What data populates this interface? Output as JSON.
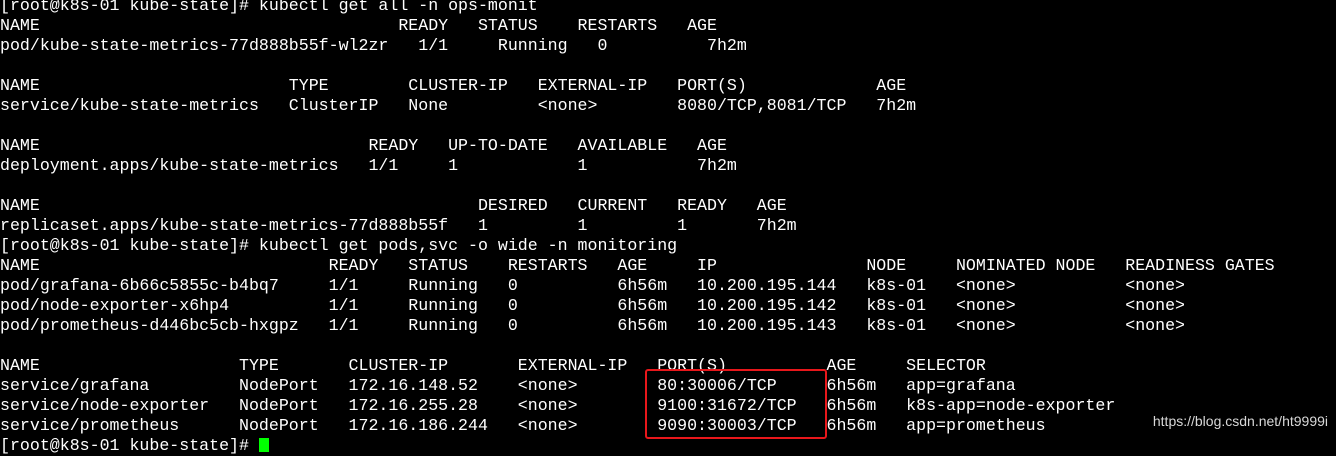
{
  "terminal": {
    "lines": [
      "[root@k8s-01 kube-state]# kubectl get all -n ops-monit",
      "NAME                                    READY   STATUS    RESTARTS   AGE",
      "pod/kube-state-metrics-77d888b55f-wl2zr   1/1     Running   0          7h2m",
      "",
      "NAME                         TYPE        CLUSTER-IP   EXTERNAL-IP   PORT(S)             AGE",
      "service/kube-state-metrics   ClusterIP   None         <none>        8080/TCP,8081/TCP   7h2m",
      "",
      "NAME                                 READY   UP-TO-DATE   AVAILABLE   AGE",
      "deployment.apps/kube-state-metrics   1/1     1            1           7h2m",
      "",
      "NAME                                            DESIRED   CURRENT   READY   AGE",
      "replicaset.apps/kube-state-metrics-77d888b55f   1         1         1       7h2m",
      "[root@k8s-01 kube-state]# kubectl get pods,svc -o wide -n monitoring",
      "NAME                             READY   STATUS    RESTARTS   AGE     IP               NODE     NOMINATED NODE   READINESS GATES",
      "pod/grafana-6b66c5855c-b4bq7     1/1     Running   0          6h56m   10.200.195.144   k8s-01   <none>           <none>",
      "pod/node-exporter-x6hp4          1/1     Running   0          6h56m   10.200.195.142   k8s-01   <none>           <none>",
      "pod/prometheus-d446bc5cb-hxgpz   1/1     Running   0          6h56m   10.200.195.143   k8s-01   <none>           <none>",
      "",
      "NAME                    TYPE       CLUSTER-IP       EXTERNAL-IP   PORT(S)          AGE     SELECTOR",
      "service/grafana         NodePort   172.16.148.52    <none>        80:30006/TCP     6h56m   app=grafana",
      "service/node-exporter   NodePort   172.16.255.28    <none>        9100:31672/TCP   6h56m   k8s-app=node-exporter",
      "service/prometheus      NodePort   172.16.186.244   <none>        9090:30003/TCP   6h56m   app=prometheus",
      "[root@k8s-01 kube-state]# "
    ]
  },
  "watermark": "https://blog.csdn.net/ht9999i",
  "colors": {
    "background": "#000000",
    "text": "#ffffff",
    "cursor": "#00ff00",
    "highlight": "#e8171b"
  }
}
